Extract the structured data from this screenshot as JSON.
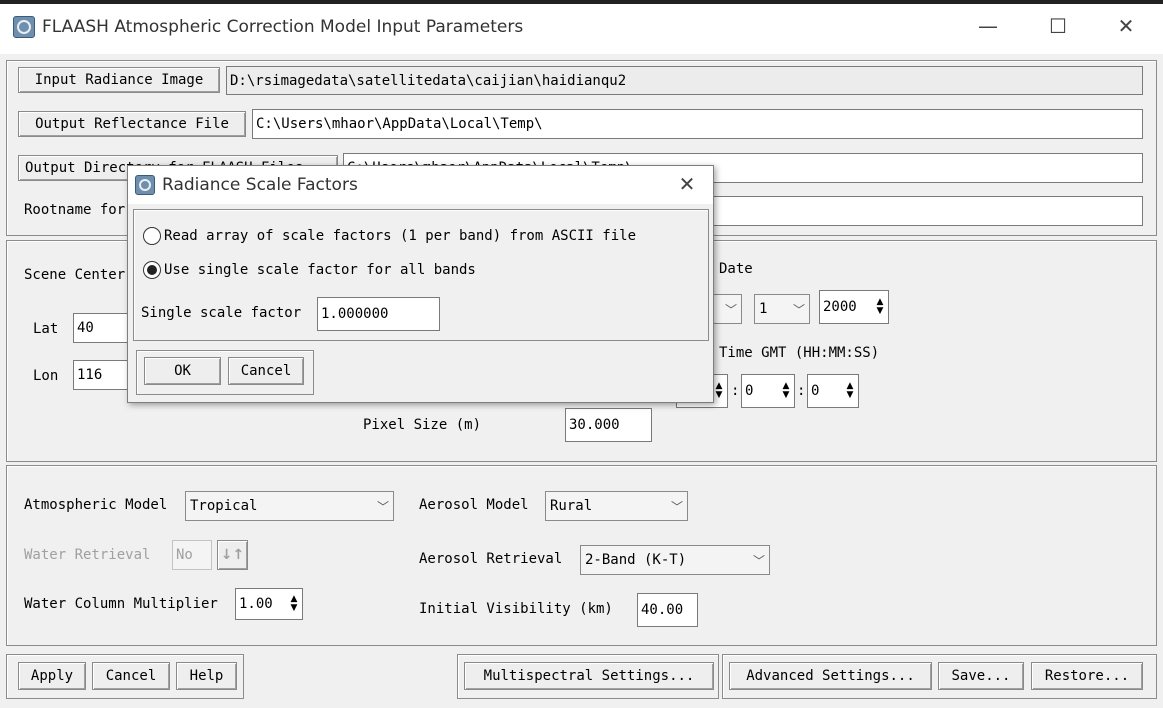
{
  "window": {
    "title": "FLAASH Atmospheric Correction Model Input Parameters",
    "minimize": "—",
    "maximize": "☐",
    "close": "✕"
  },
  "files": {
    "input_label": "Input Radiance Image",
    "input_value": "D:\\rsimagedata\\satellitedata\\caijian\\haidianqu2",
    "output_label": "Output Reflectance File",
    "output_value": "C:\\Users\\mhaor\\AppData\\Local\\Temp\\",
    "outdir_label": "Output Directory for FLAASH Files",
    "outdir_value": "C:\\Users\\mhaor\\AppData\\Local\\Temp\\",
    "rootname_label": "Rootname for FLAASH Files",
    "rootname_value": ""
  },
  "scene": {
    "center_label": "Scene Center Location",
    "lat_label": "Lat",
    "lat_value": "40",
    "lon_label": "Lon",
    "lon_value": "116",
    "date_label": "Flight Date",
    "month_value": "",
    "day_value": "1",
    "year_value": "2000",
    "time_label": "Flight Time GMT (HH:MM:SS)",
    "hour_value": "",
    "minute_value": "0",
    "second_value": "0",
    "sep": ":",
    "pixel_label": "Pixel Size (m)",
    "pixel_value": "30.000"
  },
  "atmos": {
    "model_label": "Atmospheric Model",
    "model_value": "Tropical",
    "water_label": "Water Retrieval",
    "water_value": "No",
    "water_icon": "↓↑",
    "multiplier_label": "Water Column Multiplier",
    "multiplier_value": "1.00",
    "aerosol_model_label": "Aerosol Model",
    "aerosol_model_value": "Rural",
    "aerosol_retrieval_label": "Aerosol Retrieval",
    "aerosol_retrieval_value": "2-Band (K-T)",
    "visibility_label": "Initial Visibility (km)",
    "visibility_value": "40.00"
  },
  "bottom": {
    "apply": "Apply",
    "cancel": "Cancel",
    "help": "Help",
    "multispectral": "Multispectral Settings...",
    "advanced": "Advanced Settings...",
    "save": "Save...",
    "restore": "Restore..."
  },
  "dialog": {
    "title": "Radiance Scale Factors",
    "close": "✕",
    "option1": "Read array of scale factors (1 per band) from ASCII file",
    "option2": "Use single scale factor for all bands",
    "factor_label": "Single scale factor",
    "factor_value": "1.000000",
    "ok": "OK",
    "cancel": "Cancel",
    "selected_option": 2
  }
}
